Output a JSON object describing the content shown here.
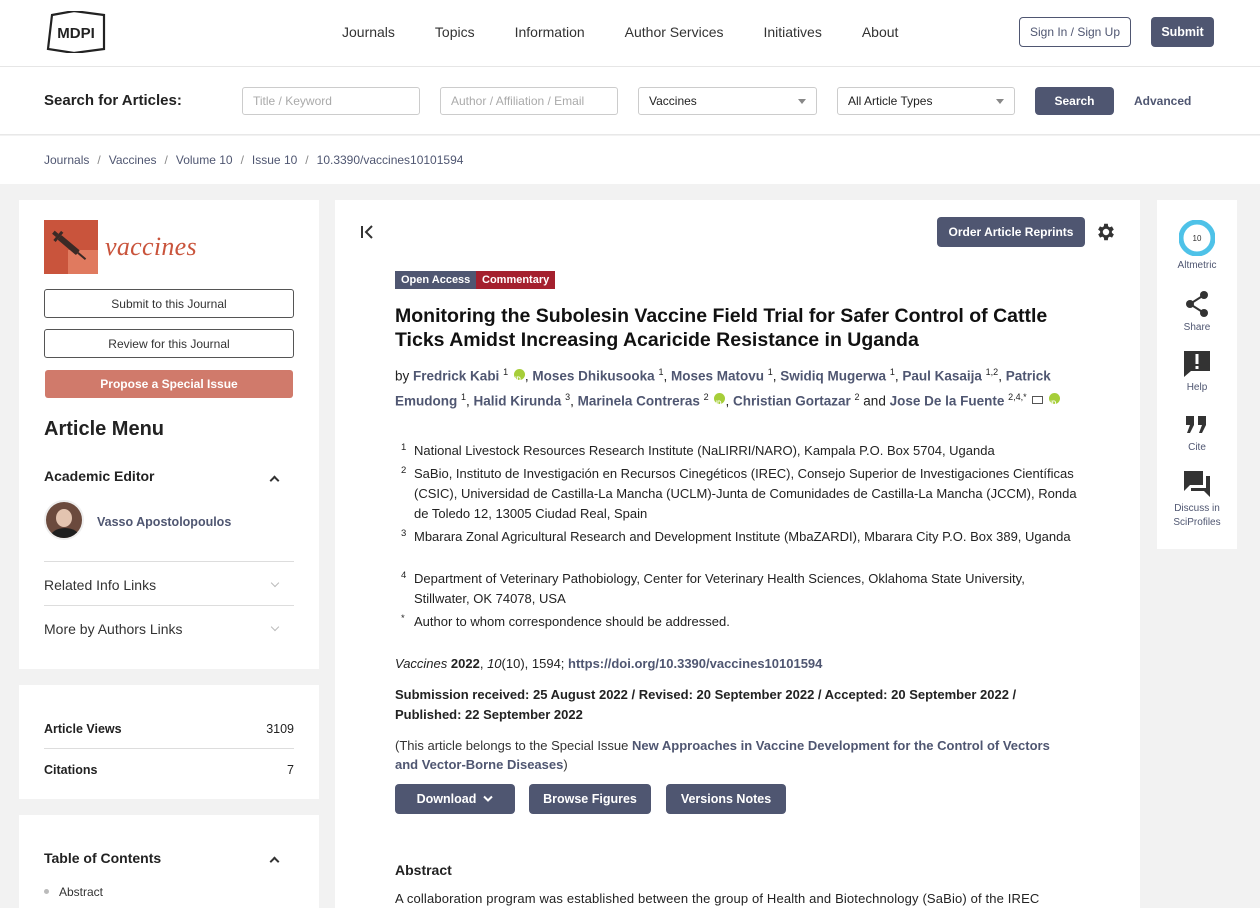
{
  "header": {
    "logo_text": "MDPI",
    "nav": [
      "Journals",
      "Topics",
      "Information",
      "Author Services",
      "Initiatives",
      "About"
    ],
    "signin_label": "Sign In / Sign Up",
    "submit_label": "Submit"
  },
  "search": {
    "label": "Search for Articles:",
    "title_placeholder": "Title / Keyword",
    "author_placeholder": "Author / Affiliation / Email",
    "journal_value": "Vaccines",
    "type_value": "All Article Types",
    "search_label": "Search",
    "advanced_label": "Advanced"
  },
  "breadcrumb": [
    "Journals",
    "Vaccines",
    "Volume 10",
    "Issue 10",
    "10.3390/vaccines10101594"
  ],
  "sidebar": {
    "journal_name": "vaccines",
    "submit_label": "Submit to this Journal",
    "review_label": "Review for this Journal",
    "propose_label": "Propose a Special Issue",
    "menu_title": "Article Menu",
    "academic_editor_title": "Academic Editor",
    "editor_name": "Vasso Apostolopoulos",
    "related_links": "Related Info Links",
    "author_links": "More by Authors Links",
    "stats": [
      {
        "label": "Article Views",
        "value": "3109"
      },
      {
        "label": "Citations",
        "value": "7"
      }
    ],
    "toc_title": "Table of Contents",
    "toc_items": [
      "Abstract"
    ]
  },
  "article": {
    "reprints_label": "Order Article Reprints",
    "badges": {
      "open_access": "Open Access",
      "type": "Commentary"
    },
    "title": "Monitoring the Subolesin Vaccine Field Trial for Safer Control of Cattle Ticks Amidst Increasing Acaricide Resistance in Uganda",
    "by": "by",
    "authors": [
      {
        "name": "Fredrick Kabi",
        "sup": "1"
      },
      {
        "name": "Moses Dhikusooka",
        "sup": "1"
      },
      {
        "name": "Moses Matovu",
        "sup": "1"
      },
      {
        "name": "Swidiq Mugerwa",
        "sup": "1"
      },
      {
        "name": "Paul Kasaija",
        "sup": "1,2"
      },
      {
        "name": "Patrick Emudong",
        "sup": "1"
      },
      {
        "name": "Halid Kirunda",
        "sup": "3"
      },
      {
        "name": "Marinela Contreras",
        "sup": "2"
      },
      {
        "name": "Christian Gortazar",
        "sup": "2"
      },
      {
        "name": "Jose De la Fuente",
        "sup": "2,4,*"
      }
    ],
    "and_word": "and",
    "affiliations": [
      {
        "num": "1",
        "text": "National Livestock Resources Research Institute (NaLIRRI/NARO), Kampala P.O. Box 5704, Uganda"
      },
      {
        "num": "2",
        "text": "SaBio, Instituto de Investigación en Recursos Cinegéticos (IREC), Consejo Superior de Investigaciones Científicas (CSIC), Universidad de Castilla-La Mancha (UCLM)-Junta de Comunidades de Castilla-La Mancha (JCCM), Ronda de Toledo 12, 13005 Ciudad Real, Spain"
      },
      {
        "num": "3",
        "text": "Mbarara Zonal Agricultural Research and Development Institute (MbaZARDI), Mbarara City P.O. Box 389, Uganda"
      },
      {
        "num": "4",
        "text": "Department of Veterinary Pathobiology, Center for Veterinary Health Sciences, Oklahoma State University, Stillwater, OK 74078, USA"
      },
      {
        "num": "*",
        "text": "Author to whom correspondence should be addressed."
      }
    ],
    "citation": {
      "journal": "Vaccines",
      "year": "2022",
      "volume": "10",
      "rest": "(10), 1594;",
      "doi": "https://doi.org/10.3390/vaccines10101594"
    },
    "dates": "Submission received: 25 August 2022 / Revised: 20 September 2022 / Accepted: 20 September 2022 / Published: 22 September 2022",
    "special_issue": {
      "prefix": "(This article belongs to the Special Issue ",
      "name": "New Approaches in Vaccine Development for the Control of Vectors and Vector-Borne Diseases",
      "suffix": ")"
    },
    "buttons": {
      "download": "Download",
      "figures": "Browse Figures",
      "versions": "Versions Notes"
    },
    "abstract_title": "Abstract",
    "abstract_start": "A collaboration program was established between the group of Health and Biotechnology (SaBio) of the IREC"
  },
  "rail": {
    "altmetric_score": "10",
    "items": [
      "Altmetric",
      "Share",
      "Help",
      "Cite",
      "Discuss in SciProfiles"
    ]
  },
  "colors": {
    "brand": "#4f5671",
    "commentary": "#a4202e",
    "journal_accent": "#c9543c",
    "propose": "#d07a6b"
  }
}
